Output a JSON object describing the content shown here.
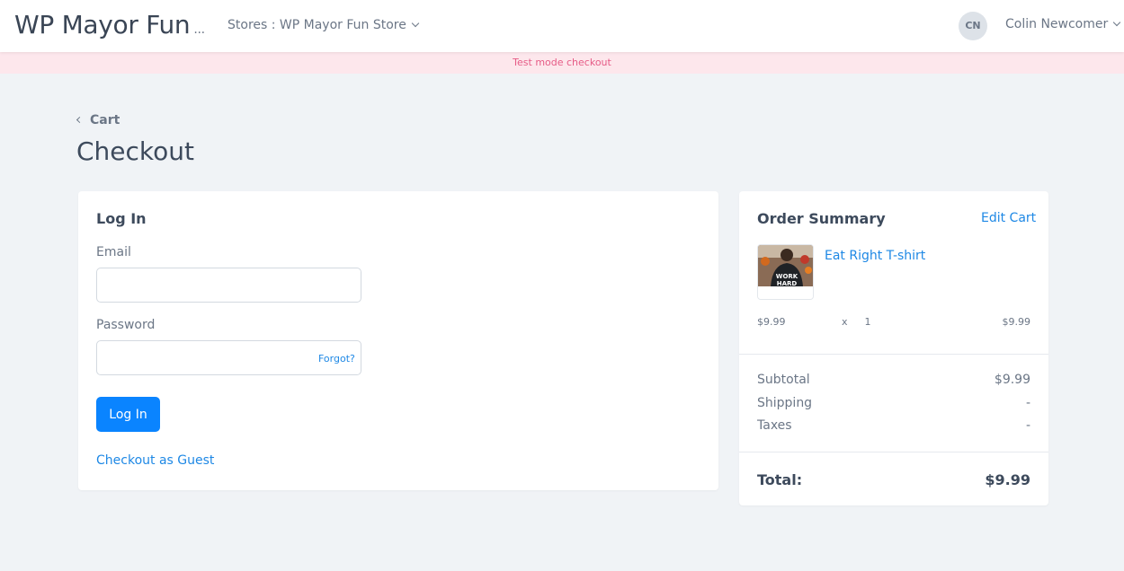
{
  "header": {
    "brand": "WP Mayor Fun",
    "brand_ellipsis": "...",
    "store_switcher": "Stores : WP Mayor Fun Store",
    "avatar_initials": "CN",
    "user_name": "Colin Newcomer"
  },
  "banner": {
    "text": "Test mode checkout"
  },
  "page": {
    "back_link": "Cart",
    "title": "Checkout"
  },
  "login": {
    "title": "Log In",
    "email_label": "Email",
    "email_value": "",
    "password_label": "Password",
    "password_value": "",
    "forgot_label": "Forgot?",
    "submit_label": "Log In",
    "guest_label": "Checkout as Guest"
  },
  "summary": {
    "title": "Order Summary",
    "edit_cart_label": "Edit Cart",
    "items": [
      {
        "name": "Eat Right T-shirt",
        "unit_price": "$9.99",
        "qty_prefix": "x",
        "qty": "1",
        "line_total": "$9.99",
        "thumb_text_1": "WORK",
        "thumb_text_2": "HARD"
      }
    ],
    "subtotal_label": "Subtotal",
    "subtotal_value": "$9.99",
    "shipping_label": "Shipping",
    "shipping_value": "-",
    "taxes_label": "Taxes",
    "taxes_value": "-",
    "total_label": "Total:",
    "total_value": "$9.99"
  },
  "colors": {
    "primary": "#0a84ff",
    "link": "#1e88e5",
    "banner_bg": "#fde7ec",
    "banner_text": "#e65b86",
    "page_bg": "#f0f3f6"
  }
}
